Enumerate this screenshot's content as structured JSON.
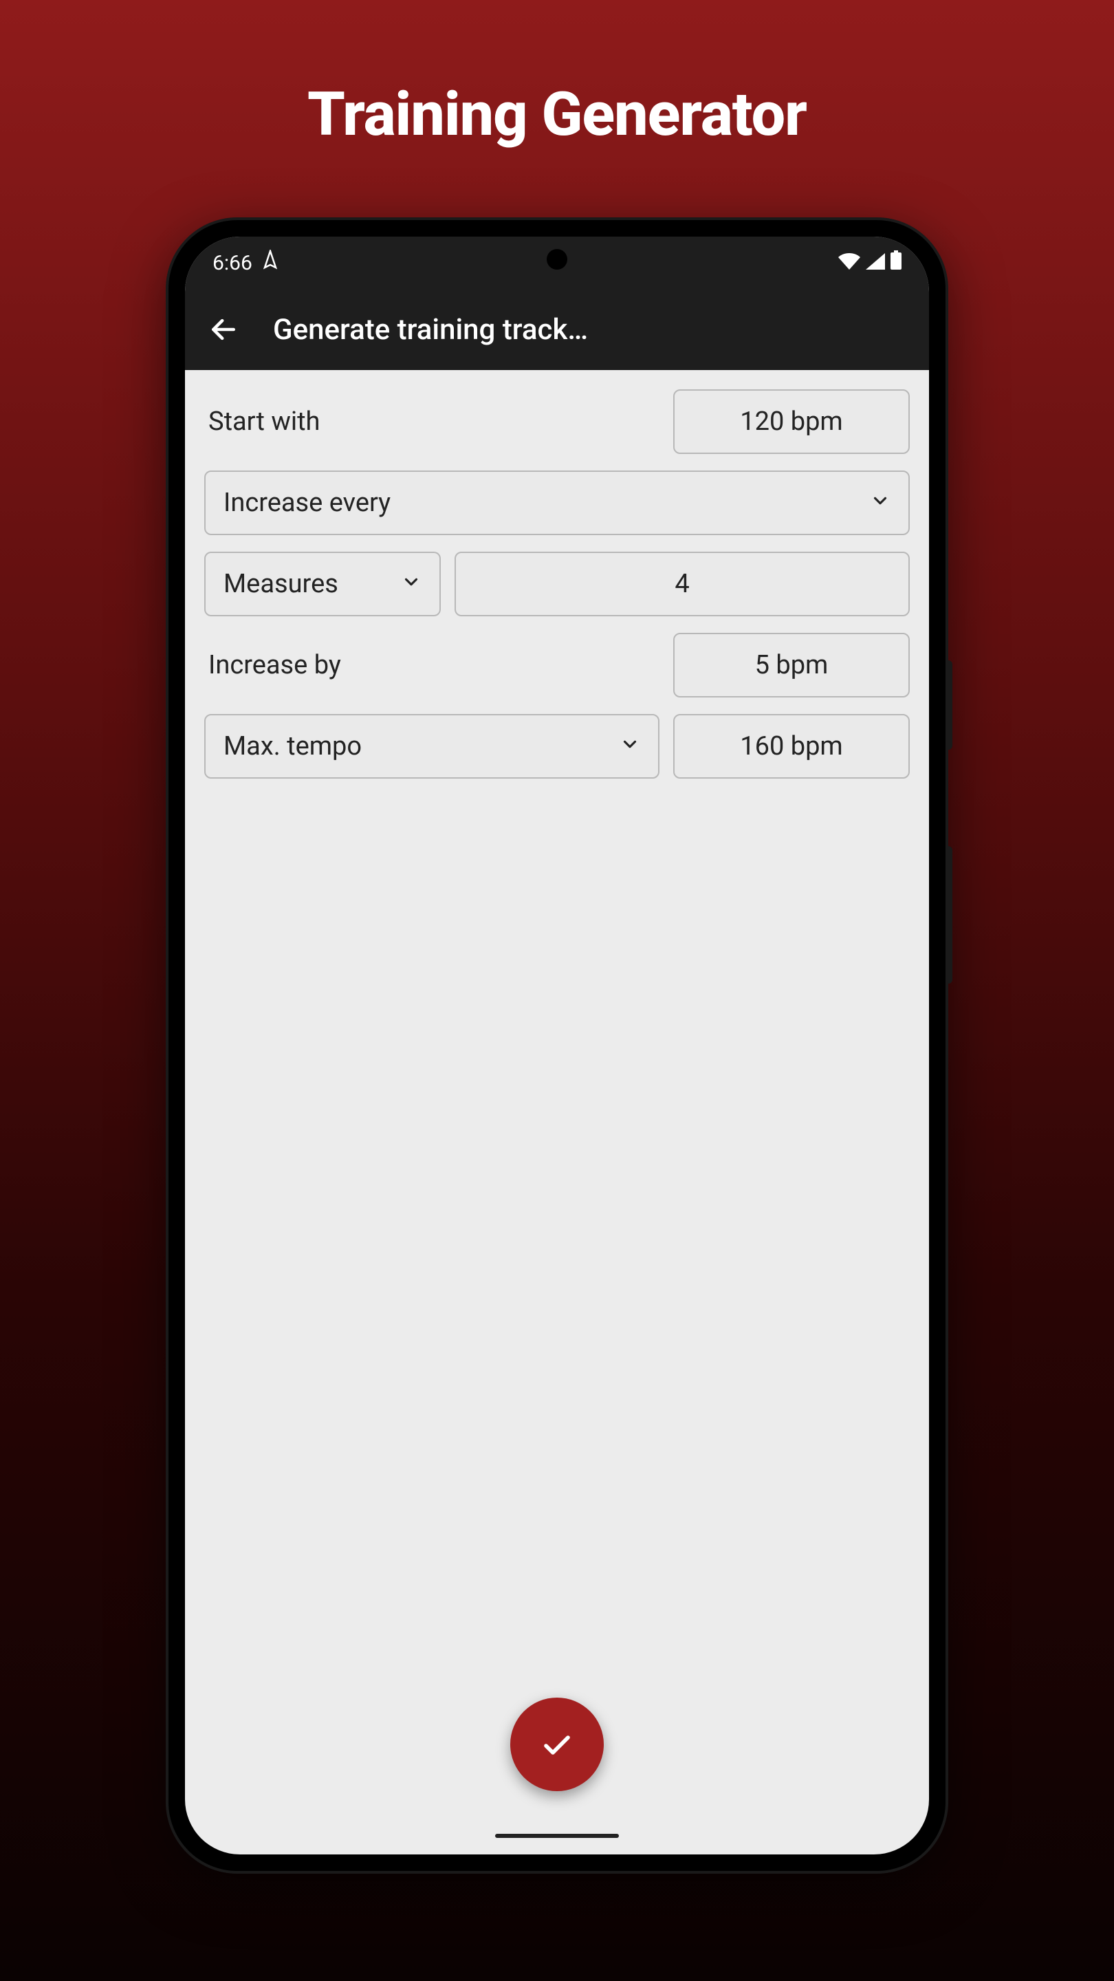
{
  "promo": {
    "title": "Training Generator"
  },
  "statusbar": {
    "time": "6:66"
  },
  "appbar": {
    "title": "Generate training track…"
  },
  "form": {
    "start_with_label": "Start with",
    "start_with_value": "120 bpm",
    "increase_every_label": "Increase every",
    "unit_label": "Measures",
    "unit_value": "4",
    "increase_by_label": "Increase by",
    "increase_by_value": "5 bpm",
    "max_tempo_label": "Max. tempo",
    "max_tempo_value": "160 bpm"
  }
}
